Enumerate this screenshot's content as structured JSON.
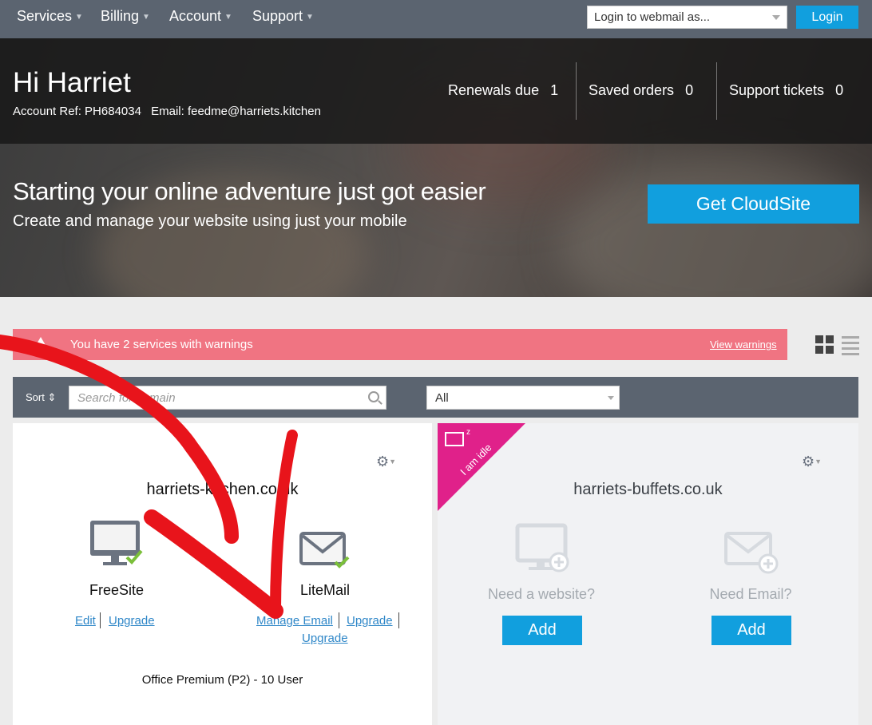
{
  "nav": {
    "items": [
      {
        "label": "Services"
      },
      {
        "label": "Billing"
      },
      {
        "label": "Account"
      },
      {
        "label": "Support"
      }
    ],
    "webmail_placeholder": "Login to webmail as...",
    "login_label": "Login"
  },
  "header": {
    "greeting": "Hi Harriet",
    "account_ref": "Account Ref: PH684034",
    "email": "Email: feedme@harriets.kitchen",
    "stats": [
      {
        "label": "Renewals due",
        "value": "1"
      },
      {
        "label": "Saved orders",
        "value": "0"
      },
      {
        "label": "Support tickets",
        "value": "0"
      }
    ]
  },
  "promo": {
    "title": "Starting your online adventure just got easier",
    "subtitle": "Create and manage your website using just your mobile",
    "button": "Get CloudSite"
  },
  "warning": {
    "text": "You have 2 services with warnings",
    "link": "View warnings"
  },
  "filters": {
    "sort_label": "Sort",
    "search_placeholder": "Search for domain",
    "select_value": "All"
  },
  "cards": [
    {
      "domain": "harriets-kitchen.co.uk",
      "website": {
        "label": "FreeSite",
        "links": [
          "Edit",
          "Upgrade"
        ]
      },
      "email": {
        "label": "LiteMail",
        "links": [
          "Manage Email",
          "Upgrade",
          "Upgrade"
        ]
      },
      "plan": "Office Premium (P2) - 10 User"
    },
    {
      "domain": "harriets-buffets.co.uk",
      "ribbon": "I am idle",
      "website": {
        "label": "Need a website?",
        "button": "Add"
      },
      "email": {
        "label": "Need Email?",
        "button": "Add"
      }
    }
  ],
  "colors": {
    "nav_bg": "#5b6470",
    "accent": "#119fde",
    "warning": "#f07482",
    "idle_ribbon": "#e0218a",
    "check": "#7bbf3a",
    "annotation_arrow": "#e8141b"
  }
}
